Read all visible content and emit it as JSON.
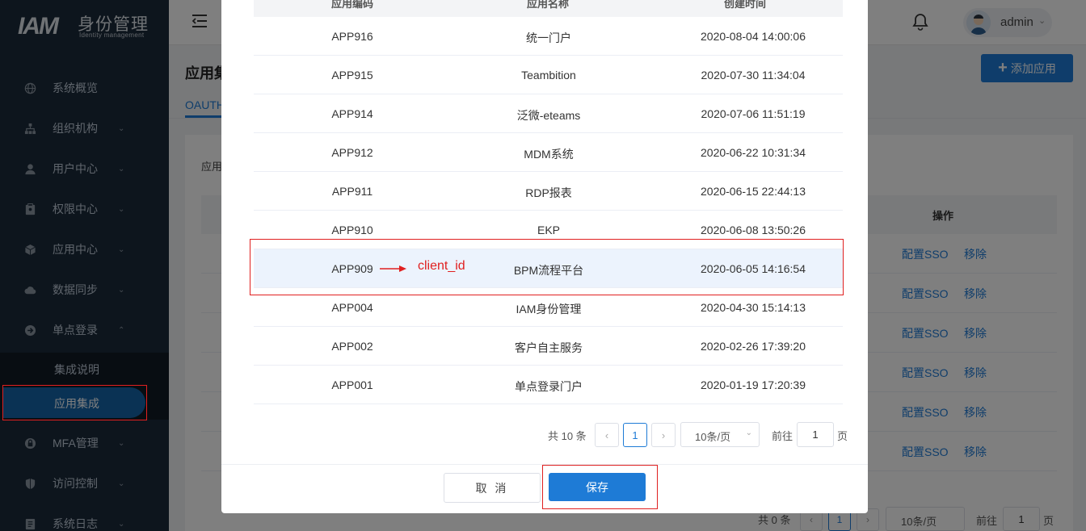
{
  "logo": {
    "mark": "IAM",
    "cn": "身份管理",
    "en": "Identity management"
  },
  "sidebar": {
    "items": [
      {
        "label": "系统概览",
        "icon": "globe-icon",
        "arrow": ""
      },
      {
        "label": "组织机构",
        "icon": "org-tree-icon",
        "arrow": "⌄"
      },
      {
        "label": "用户中心",
        "icon": "user-icon",
        "arrow": "⌄"
      },
      {
        "label": "权限中心",
        "icon": "clipboard-icon",
        "arrow": "⌄"
      },
      {
        "label": "应用中心",
        "icon": "cube-icon",
        "arrow": "⌄"
      },
      {
        "label": "数据同步",
        "icon": "cloud-sync-icon",
        "arrow": "⌄"
      },
      {
        "label": "单点登录",
        "icon": "login-arrow-icon",
        "arrow": "⌃"
      },
      {
        "label": "MFA管理",
        "icon": "lock-icon",
        "arrow": "⌄"
      },
      {
        "label": "访问控制",
        "icon": "shield-icon",
        "arrow": "⌄"
      },
      {
        "label": "系统日志",
        "icon": "log-icon",
        "arrow": "⌄"
      }
    ],
    "sub_items": [
      {
        "label": "集成说明"
      },
      {
        "label": "应用集成"
      }
    ]
  },
  "header": {
    "username": "admin"
  },
  "page": {
    "title": "应用集",
    "add_button": "添加应用",
    "tab": "OAUTH",
    "card_label": "应用",
    "op_header": "操作",
    "row_actions": {
      "config": "配置SSO",
      "remove": "移除"
    },
    "pager": {
      "total": "共 0 条",
      "page": "1",
      "size": "10条/页",
      "goto": "前往",
      "goto_value": "1",
      "unit": "页"
    }
  },
  "dialog": {
    "columns": [
      "应用编码",
      "应用名称",
      "创建时间"
    ],
    "rows": [
      {
        "code": "APP916",
        "name": "统一门户",
        "created": "2020-08-04 14:00:06"
      },
      {
        "code": "APP915",
        "name": "Teambition",
        "created": "2020-07-30 11:34:04"
      },
      {
        "code": "APP914",
        "name": "泛微-eteams",
        "created": "2020-07-06 11:51:19"
      },
      {
        "code": "APP912",
        "name": "MDM系统",
        "created": "2020-06-22 10:31:34"
      },
      {
        "code": "APP911",
        "name": "RDP报表",
        "created": "2020-06-15 22:44:13"
      },
      {
        "code": "APP910",
        "name": "EKP",
        "created": "2020-06-08 13:50:26"
      },
      {
        "code": "APP909",
        "name": "BPM流程平台",
        "created": "2020-06-05 14:16:54"
      },
      {
        "code": "APP004",
        "name": "IAM身份管理",
        "created": "2020-04-30 15:14:13"
      },
      {
        "code": "APP002",
        "name": "客户自主服务",
        "created": "2020-02-26 17:39:20"
      },
      {
        "code": "APP001",
        "name": "单点登录门户",
        "created": "2020-01-19 17:20:39"
      }
    ],
    "annotation": "client_id",
    "pager": {
      "total": "共 10 条",
      "page": "1",
      "size": "10条/页",
      "goto": "前往",
      "goto_value": "1",
      "unit": "页"
    },
    "cancel_label": "取 消",
    "save_label": "保存"
  },
  "colors": {
    "accent": "#1e7bd6",
    "sidebar": "#1b2a3a",
    "annotation": "#e02020"
  }
}
